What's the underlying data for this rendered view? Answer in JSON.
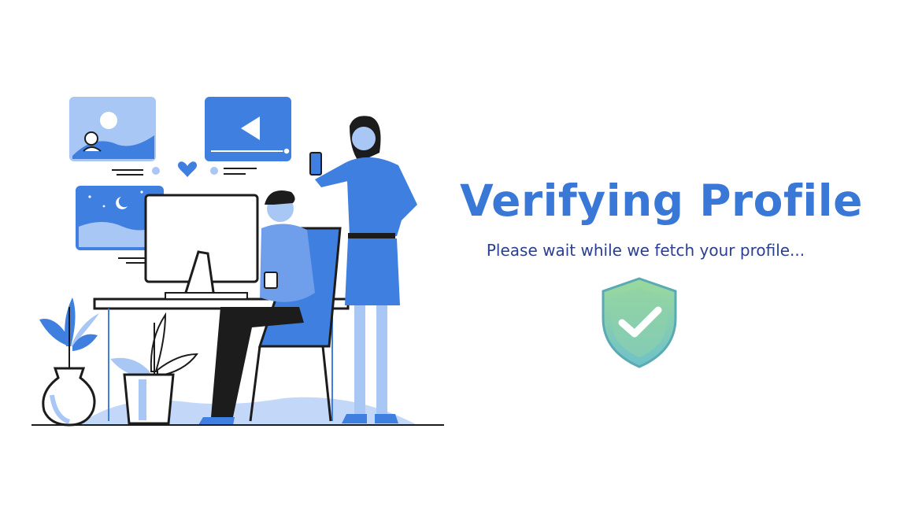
{
  "heading": {
    "title": "Verifying Profile",
    "subtitle": "Please wait while we fetch your profile..."
  },
  "colors": {
    "title": "#3a78d8",
    "subtitle": "#2a3f8f",
    "accent_blue": "#3f7fe0",
    "light_blue": "#a9c7f5",
    "shield_green": "#8fd6a0",
    "shield_teal": "#79c7c9",
    "dark": "#1c1c1c"
  },
  "icons": {
    "status": "shield-check-icon",
    "illustration": "office-workers-illustration"
  }
}
